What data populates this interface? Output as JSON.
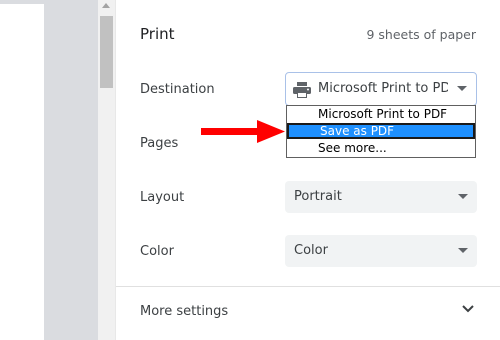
{
  "print": {
    "title": "Print",
    "sheets": "9 sheets of paper"
  },
  "destination": {
    "label": "Destination",
    "value": "Microsoft Print to PDF",
    "icon": "printer-icon",
    "options": [
      "Microsoft Print to PDF",
      "Save as PDF",
      "See more..."
    ],
    "highlighted_option": "Save as PDF"
  },
  "pages": {
    "label": "Pages"
  },
  "layout": {
    "label": "Layout",
    "value": "Portrait"
  },
  "color": {
    "label": "Color",
    "value": "Color"
  },
  "more_settings": {
    "label": "More settings"
  },
  "colors": {
    "highlight": "#1e90ff",
    "arrow": "#ff0000",
    "select_bg": "#f1f3f4"
  }
}
